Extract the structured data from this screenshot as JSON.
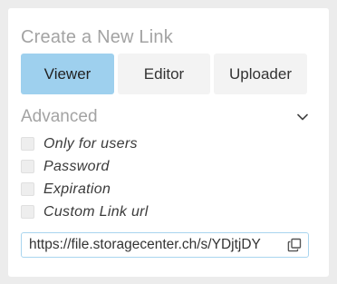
{
  "panel": {
    "title": "Create a New Link",
    "roles": [
      {
        "label": "Viewer",
        "active": true
      },
      {
        "label": "Editor",
        "active": false
      },
      {
        "label": "Uploader",
        "active": false
      }
    ],
    "advanced": {
      "label": "Advanced",
      "expanded": true,
      "icon": "chevron-down-icon"
    },
    "options": [
      {
        "label": "Only for users",
        "checked": false
      },
      {
        "label": "Password",
        "checked": false
      },
      {
        "label": "Expiration",
        "checked": false
      },
      {
        "label": "Custom Link url",
        "checked": false
      }
    ],
    "link": {
      "url": "https://file.storagecenter.ch/s/YDjtjDY",
      "copy_icon": "copy-icon"
    }
  },
  "colors": {
    "active_role_bg": "#9ed0ee",
    "inactive_role_bg": "#f3f3f3",
    "muted_text": "#a3a3a3",
    "url_border": "#a9d5ef"
  }
}
